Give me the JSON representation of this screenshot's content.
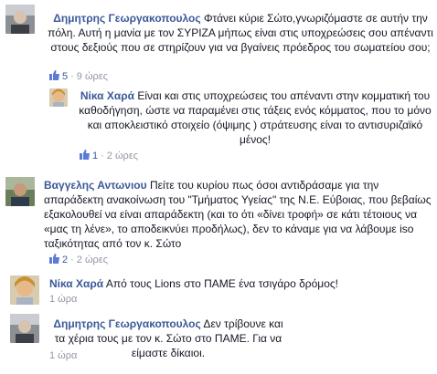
{
  "comments": [
    {
      "author": "Δημητρης Γεωργακοπουλος",
      "text": "Φτάνει κύριε Σώτο,γνωριζόμαστε σε αυτήν την πόλη. Αυτή η μανία με τον ΣΥΡΙΖΑ μήπως είναι στις υποχρεώσεις σου απέναντι στους δεξιούς που σε στηρίζουν για να βγαίνεις πρόεδρος του σωματείου σου;",
      "likes": "5",
      "time": "9 ώρες"
    },
    {
      "author": "Νίκα Χαρά",
      "text": "Είναι και στις υποχρεώσεις του απέναντι στην κομματική του καθοδήγηση, ώστε να παραμένει στις τάξεις ενός κόμματος, που το μόνο και αποκλειστικό στοιχείο (όψιμης ) στράτευσης είναι το αντισυριζαϊκό μένος!",
      "likes": "1",
      "time": "2 ώρες"
    },
    {
      "author": "Βαγγελης Αντωνιου",
      "text": "Πείτε του κυρίου πως όσοι αντιδράσαμε για την απαράδεκτη ανακοίνωση του \"Τμήματος Υγείας\" της Ν.Ε. Εύβοιας, που βεβαίως εξακολουθεί να είναι απαράδεκτη (και το ότι «δίνει τροφή» σε κάτι τέτοιους να «μας τη λένε», το αποδεικνύει προδήλως), δεν το κάναμε για να λάβουμε iso ταξικότητας από τον κ. Σώτο",
      "likes": "2",
      "time": "2 ώρες"
    },
    {
      "author": "Νίκα Χαρά",
      "text": "Από τους Lions στο ΠΑΜΕ ένα τσιγάρο δρόμος!",
      "time": "1 ώρα"
    },
    {
      "author": "Δημητρης Γεωργακοπουλος",
      "text": "Δεν τρίβουνε και τα χέρια τους με τον κ. Σώτο στο ΠΑΜΕ. Για να είμαστε δίκαιοι.",
      "time": "1 ώρα"
    }
  ],
  "separator": "·",
  "colors": {
    "link": "#3b5998",
    "text": "#141823",
    "meta": "#9197a3"
  }
}
